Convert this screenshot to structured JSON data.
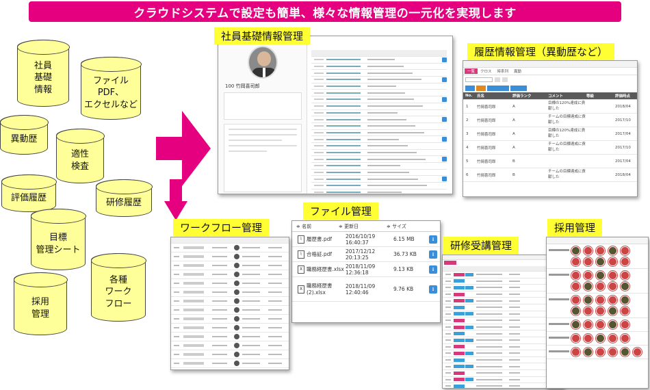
{
  "banner": {
    "title": "クラウドシステムで設定も簡単、様々な情報管理の一元化を実現します"
  },
  "cylinders": [
    {
      "id": "c1",
      "label": "社員\n基礎\n情報"
    },
    {
      "id": "c2",
      "label": "ファイル\nPDF、\nエクセルなど"
    },
    {
      "id": "c3",
      "label": "異動歴"
    },
    {
      "id": "c4",
      "label": "適性\n検査"
    },
    {
      "id": "c5",
      "label": "評価履歴"
    },
    {
      "id": "c6",
      "label": "研修履歴"
    },
    {
      "id": "c7",
      "label": "目標\n管理シート"
    },
    {
      "id": "c8",
      "label": "各種\nワーク\nフロー"
    },
    {
      "id": "c9",
      "label": "採用\n管理"
    }
  ],
  "panels": {
    "employee": {
      "label": "社員基礎情報管理",
      "name": "100 竹岡喜司郎"
    },
    "history": {
      "label": "履歴情報管理（異動歴など）",
      "tabs": [
        "一覧",
        "クロス",
        "時系列",
        "異動"
      ],
      "columns": [
        "No.",
        "氏名",
        "評価ランク",
        "コメント",
        "等級",
        "評価時点"
      ],
      "rows": [
        {
          "no": "1",
          "name": "竹岡喜司郎",
          "rank": "A",
          "comment": "目標の120%達成に貢献した",
          "date": "2018/04"
        },
        {
          "no": "2",
          "name": "竹岡喜司郎",
          "rank": "A",
          "comment": "チームの目標達成に貢献した",
          "date": "2017/10"
        },
        {
          "no": "3",
          "name": "竹岡喜司郎",
          "rank": "A",
          "comment": "目標の120%達成に貢献した",
          "date": "2017/04"
        },
        {
          "no": "4",
          "name": "竹岡喜司郎",
          "rank": "A",
          "comment": "チームの目標達成に貢献した",
          "date": "2017/10"
        },
        {
          "no": "5",
          "name": "竹岡喜司郎",
          "rank": "B",
          "comment": "",
          "date": "2017/04"
        },
        {
          "no": "6",
          "name": "竹岡喜司郎",
          "rank": "B",
          "comment": "チームの目標達成に貢献した",
          "date": "2018/04"
        }
      ]
    },
    "files": {
      "label": "ファイル管理",
      "columns": [
        "名前",
        "更新日",
        "サイズ"
      ],
      "rows": [
        {
          "icon": "pdf",
          "name": "履歴書.pdf",
          "date": "2016/10/19 16:40:37",
          "size": "6.15 MB"
        },
        {
          "icon": "pdf",
          "name": "合格証.pdf",
          "date": "2017/12/12 20:13:25",
          "size": "36.73 KB"
        },
        {
          "icon": "xls",
          "name": "職務経歴書.xlsx",
          "date": "2018/11/09 12:36:18",
          "size": "9.13 KB"
        },
        {
          "icon": "xls",
          "name": "職務経歴書\n(2).xlsx",
          "date": "2018/11/09 12:40:46",
          "size": "9.76 KB"
        }
      ]
    },
    "workflow": {
      "label": "ワークフロー管理"
    },
    "training": {
      "label": "研修受講管理"
    },
    "recruit": {
      "label": "採用管理"
    }
  },
  "colors": {
    "banner": "#e4007f",
    "cylinder": "#ffff99",
    "label": "#ffff33",
    "arrow": "#e4007f"
  }
}
